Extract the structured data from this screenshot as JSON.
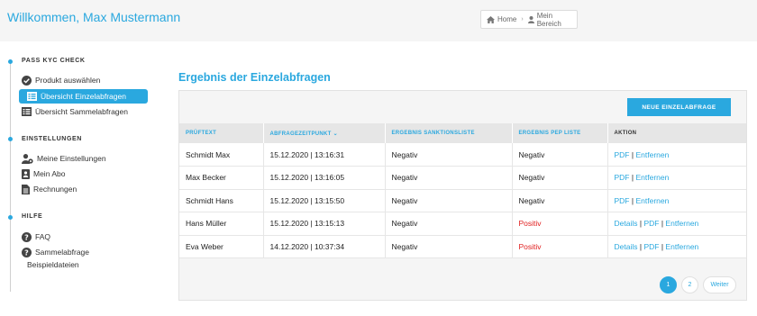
{
  "header": {
    "welcome": "Willkommen, Max Mustermann",
    "breadcrumb": {
      "home": "Home",
      "current": "Mein Bereich"
    }
  },
  "sidebar": {
    "sections": [
      {
        "title": "PASS KYC CHECK",
        "items": [
          {
            "label": "Produkt auswählen",
            "icon": "check-circle-icon"
          },
          {
            "label": "Übersicht Einzelabfragen",
            "icon": "list-icon",
            "active": true
          },
          {
            "label": "Übersicht Sammelabfragen",
            "icon": "list-icon"
          }
        ]
      },
      {
        "title": "EINSTELLUNGEN",
        "items": [
          {
            "label": "Meine Einstellungen",
            "icon": "user-gear-icon"
          },
          {
            "label": "Mein Abo",
            "icon": "id-card-icon"
          },
          {
            "label": "Rechnungen",
            "icon": "document-icon"
          }
        ]
      },
      {
        "title": "HILFE",
        "items": [
          {
            "label": "FAQ",
            "icon": "question-icon"
          },
          {
            "label": "Sammelabfrage",
            "label2": "Beispieldateien",
            "icon": "question-icon"
          }
        ]
      }
    ]
  },
  "main": {
    "title": "Ergebnis der Einzelabfragen",
    "new_button": "NEUE EINZELABFRAGE",
    "columns": [
      "PRÜFTEXT",
      "ABFRAGEZEITPUNKT",
      "ERGEBNIS SANKTIONSLISTE",
      "ERGEBNIS PEP LISTE",
      "AKTION"
    ],
    "rows": [
      {
        "name": "Schmidt Max",
        "time": "15.12.2020 | 13:16:31",
        "sanktion": "Negativ",
        "pep": "Negativ",
        "actions": [
          "PDF",
          "Entfernen"
        ]
      },
      {
        "name": "Max Becker",
        "time": "15.12.2020 | 13:16:05",
        "sanktion": "Negativ",
        "pep": "Negativ",
        "actions": [
          "PDF",
          "Entfernen"
        ]
      },
      {
        "name": "Schmidt Hans",
        "time": "15.12.2020 | 13:15:50",
        "sanktion": "Negativ",
        "pep": "Negativ",
        "actions": [
          "PDF",
          "Entfernen"
        ]
      },
      {
        "name": "Hans Müller",
        "time": "15.12.2020 | 13:15:13",
        "sanktion": "Negativ",
        "pep": "Positiv",
        "actions": [
          "Details",
          "PDF",
          "Entfernen"
        ]
      },
      {
        "name": "Eva Weber",
        "time": "14.12.2020 | 10:37:34",
        "sanktion": "Negativ",
        "pep": "Positiv",
        "actions": [
          "Details",
          "PDF",
          "Entfernen"
        ]
      }
    ],
    "pagination": {
      "pages": [
        "1",
        "2"
      ],
      "current": "1",
      "next": "Weiter"
    }
  },
  "colors": {
    "accent": "#2aa8df",
    "positive": "#e02020"
  }
}
